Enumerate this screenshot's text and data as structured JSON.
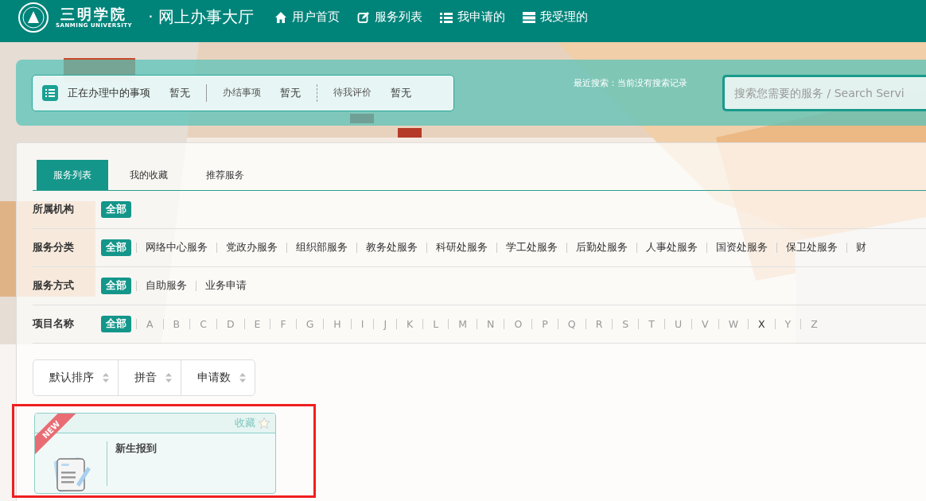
{
  "header": {
    "logo_name": "三明学院",
    "logo_subtitle": "SANMING UNIVERSITY",
    "site_title": "· 网上办事大厅",
    "nav": [
      {
        "label": "用户首页",
        "kind": "home"
      },
      {
        "label": "服务列表",
        "kind": "edit"
      },
      {
        "label": "我申请的",
        "kind": "list"
      },
      {
        "label": "我受理的",
        "kind": "stack"
      }
    ]
  },
  "status": {
    "items": [
      {
        "label": "正在办理中的事项",
        "value": "暂无"
      },
      {
        "label": "办结事项",
        "value": "暂无"
      },
      {
        "label": "待我评价",
        "value": "暂无"
      }
    ],
    "recent_search": "最近搜索：当前没有搜索记录",
    "search": {
      "placeholder": "搜索您需要的服务 / Search Servi"
    }
  },
  "tabs": [
    {
      "label": "服务列表",
      "selected": true
    },
    {
      "label": "我的收藏",
      "selected": false
    },
    {
      "label": "推荐服务",
      "selected": false
    }
  ],
  "filters": [
    {
      "label": "所属机构",
      "options": [
        {
          "label": "全部",
          "selected": true
        }
      ]
    },
    {
      "label": "服务分类",
      "options": [
        {
          "label": "全部",
          "selected": true
        },
        {
          "label": "网络中心服务",
          "selected": false
        },
        {
          "label": "党政办服务",
          "selected": false
        },
        {
          "label": "组织部服务",
          "selected": false
        },
        {
          "label": "教务处服务",
          "selected": false
        },
        {
          "label": "科研处服务",
          "selected": false
        },
        {
          "label": "学工处服务",
          "selected": false
        },
        {
          "label": "后勤处服务",
          "selected": false
        },
        {
          "label": "人事处服务",
          "selected": false
        },
        {
          "label": "国资处服务",
          "selected": false
        },
        {
          "label": "保卫处服务",
          "selected": false
        },
        {
          "label": "财",
          "selected": false
        }
      ]
    },
    {
      "label": "服务方式",
      "options": [
        {
          "label": "全部",
          "selected": true
        },
        {
          "label": "自助服务",
          "selected": false
        },
        {
          "label": "业务申请",
          "selected": false
        }
      ]
    },
    {
      "label": "项目名称",
      "kind": "letters",
      "options": [
        {
          "label": "全部",
          "selected": true
        },
        {
          "label": "A",
          "disabled": true
        },
        {
          "label": "B",
          "disabled": true
        },
        {
          "label": "C",
          "disabled": true
        },
        {
          "label": "D",
          "disabled": true
        },
        {
          "label": "E",
          "disabled": true
        },
        {
          "label": "F",
          "disabled": true
        },
        {
          "label": "G",
          "disabled": true
        },
        {
          "label": "H",
          "disabled": true
        },
        {
          "label": "I",
          "disabled": true
        },
        {
          "label": "J",
          "disabled": true
        },
        {
          "label": "K",
          "disabled": true
        },
        {
          "label": "L",
          "disabled": true
        },
        {
          "label": "M",
          "disabled": true
        },
        {
          "label": "N",
          "disabled": true
        },
        {
          "label": "O",
          "disabled": true
        },
        {
          "label": "P",
          "disabled": true
        },
        {
          "label": "Q",
          "disabled": true
        },
        {
          "label": "R",
          "disabled": true
        },
        {
          "label": "S",
          "disabled": true
        },
        {
          "label": "T",
          "disabled": true
        },
        {
          "label": "U",
          "disabled": true
        },
        {
          "label": "V",
          "disabled": true
        },
        {
          "label": "W",
          "disabled": true
        },
        {
          "label": "X",
          "disabled": false
        },
        {
          "label": "Y",
          "disabled": true
        },
        {
          "label": "Z",
          "disabled": true
        }
      ]
    }
  ],
  "sort": [
    "默认排序",
    "拼音",
    "申请数"
  ],
  "cards": [
    {
      "badge": "NEW",
      "favorite": "收藏",
      "title": "新生报到",
      "highlighted": true
    }
  ]
}
